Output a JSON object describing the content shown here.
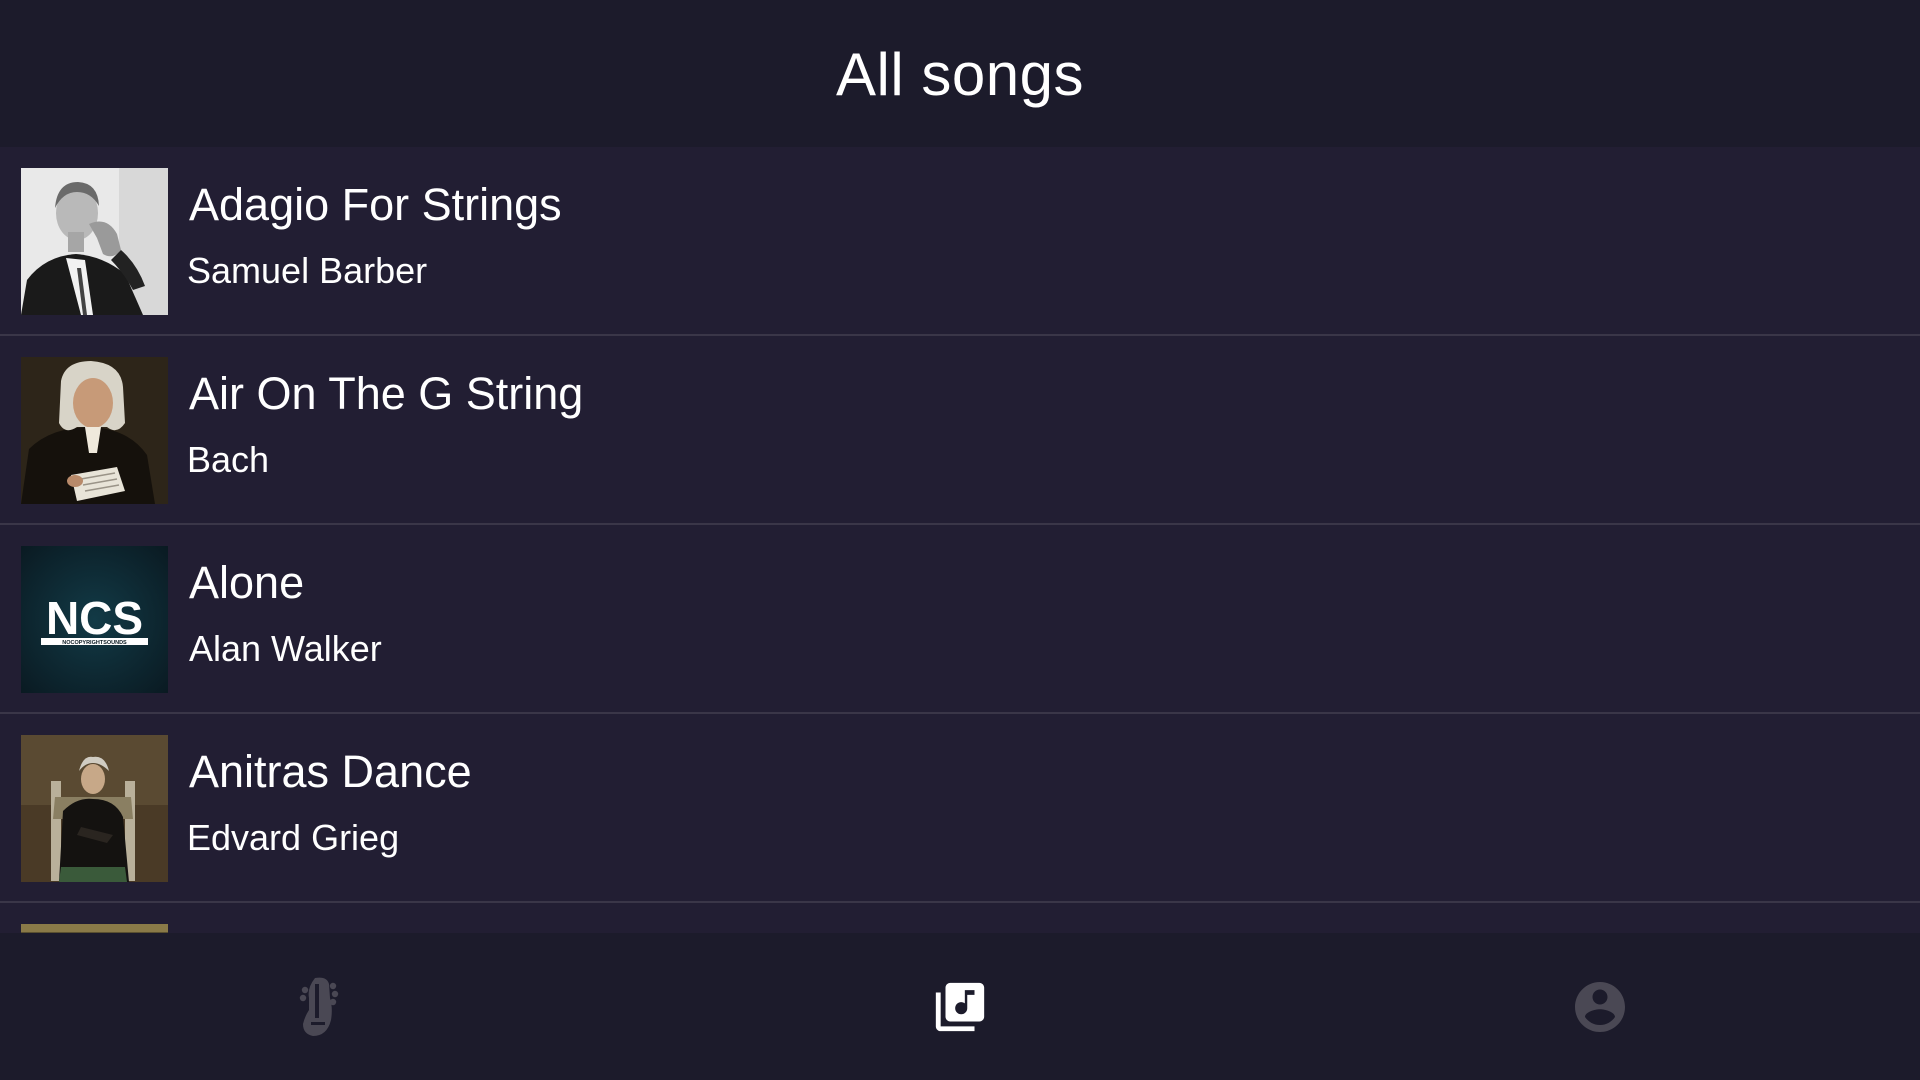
{
  "header": {
    "title": "All songs"
  },
  "songs": [
    {
      "title": "Adagio For Strings",
      "artist": "Samuel Barber"
    },
    {
      "title": "Air On The G String",
      "artist": "Bach"
    },
    {
      "title": "Alone",
      "artist": "Alan Walker",
      "cover_text": "NCS",
      "cover_subtext": "NOCOPYRIGHTSOUNDS"
    },
    {
      "title": "Anitras Dance",
      "artist": "Edvard Grieg"
    }
  ],
  "bottom_nav": {
    "items": [
      {
        "icon": "guitar-icon",
        "active": false
      },
      {
        "icon": "music-library-icon",
        "active": true
      },
      {
        "icon": "account-icon",
        "active": false
      }
    ]
  },
  "colors": {
    "header_bg": "#1c1b2b",
    "list_bg": "#221e33",
    "divider": "#3a3648",
    "active_icon": "#ffffff",
    "inactive_icon": "#4a4854"
  }
}
